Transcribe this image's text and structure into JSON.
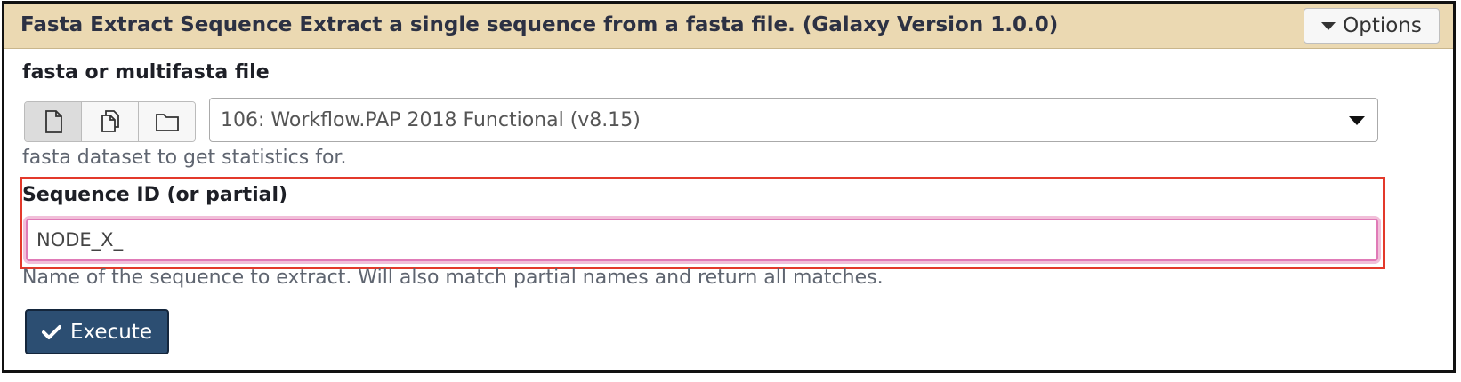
{
  "tool": {
    "title": "Fasta Extract Sequence Extract a single sequence from a fasta file. (Galaxy Version 1.0.0)",
    "options_label": "Options"
  },
  "input_file": {
    "label": "fasta or multifasta file",
    "buttons": [
      "file-icon",
      "multiple-files-icon",
      "folder-icon"
    ],
    "selected_value": "106: Workflow.PAP 2018 Functional (v8.15)",
    "help": "fasta dataset to get statistics for."
  },
  "sequence_id": {
    "label": "Sequence ID (or partial)",
    "value": "NODE_X_",
    "help": "Name of the sequence to extract. Will also match partial names and return all matches."
  },
  "execute": {
    "label": "Execute"
  },
  "colors": {
    "header_bg": "#ebd9b2",
    "highlight_border": "#e3392b",
    "input_focus": "#e07ab7",
    "execute_bg": "#2c4e72"
  }
}
